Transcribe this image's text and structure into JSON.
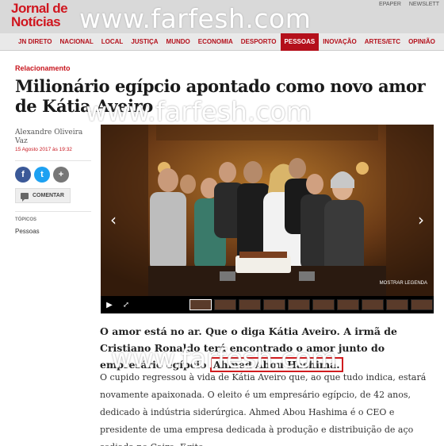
{
  "header": {
    "logo_line1": "Jornal de",
    "logo_line2": "Notícias",
    "watermark": "www.farfesh.com",
    "top_links": [
      "EPAPER",
      "NEWSLETT"
    ]
  },
  "nav": {
    "items": [
      "JN DIRETO",
      "NACIONAL",
      "LOCAL",
      "JUSTIÇA",
      "MUNDO",
      "ECONOMIA",
      "DESPORTO",
      "PESSOAS",
      "INOVAÇÃO",
      "ARTES/ETC",
      "OPINIÃO"
    ],
    "active": "PESSOAS"
  },
  "article": {
    "section": "Relacionamento",
    "title": "Milionário egípcio apontado como novo amor de Kátia Aveiro",
    "author": "Alexandre Oliveira Vaz",
    "date": "15 Agosto 2017 às 19:32",
    "comment_label": "COMENTAR",
    "topics_label": "TÓPICOS",
    "topics_item": "Pessoas",
    "lead_text": "O amor está no ar. Que o diga Kátia Aveiro. A irmã de Cristiano Ronaldo terá encontrado o amor junto do empresário egípcio ",
    "lead_highlight": "Ahmed Abou Hashima.",
    "body": "O cupido regressou à vida de Kátia Aveiro que, ao que tudo indica, estará novamente apaixonada. O eleito é um empresário egípcio, de 42 anos, dedicado à indústria siderúrgica. Ahmed Abou Hashima é o CEO e presidente de uma empresa dedicada à produção e distribuição de aço sediada no Cairo, Egito."
  },
  "gallery": {
    "legend_label": "MOSTRAR LEGENDA",
    "thumbnail_count": 10
  },
  "social": {
    "facebook_icon": "f",
    "twitter_icon": "t",
    "plus_icon": "+"
  },
  "colors": {
    "brand_red": "#c8161e",
    "nav_active": "#b4101b",
    "highlight_box": "#d01c1f"
  }
}
